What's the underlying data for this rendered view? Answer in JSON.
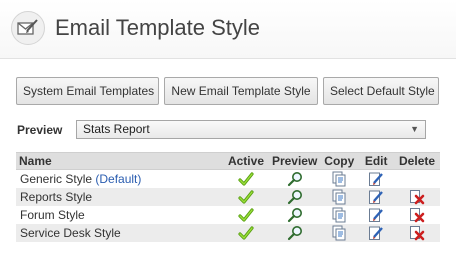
{
  "header": {
    "title": "Email Template Style",
    "logo_icon": "compose-email-icon"
  },
  "toolbar": {
    "buttons": [
      {
        "label": "System Email Templates"
      },
      {
        "label": "New Email Template Style"
      },
      {
        "label": "Select Default Style"
      }
    ]
  },
  "preview": {
    "label": "Preview",
    "selected": "Stats Report"
  },
  "table": {
    "columns": [
      "Name",
      "Active",
      "Preview",
      "Copy",
      "Edit",
      "Delete"
    ],
    "rows": [
      {
        "name": "Generic Style",
        "default_tag": "(Default)",
        "active": true,
        "deletable": false
      },
      {
        "name": "Reports Style",
        "default_tag": "",
        "active": true,
        "deletable": true
      },
      {
        "name": "Forum Style",
        "default_tag": "",
        "active": true,
        "deletable": true
      },
      {
        "name": "Service Desk Style",
        "default_tag": "",
        "active": true,
        "deletable": true
      }
    ]
  },
  "colors": {
    "check": "#7cc31e",
    "delete": "#cc1f1f",
    "default_tag": "#2a5db0"
  }
}
